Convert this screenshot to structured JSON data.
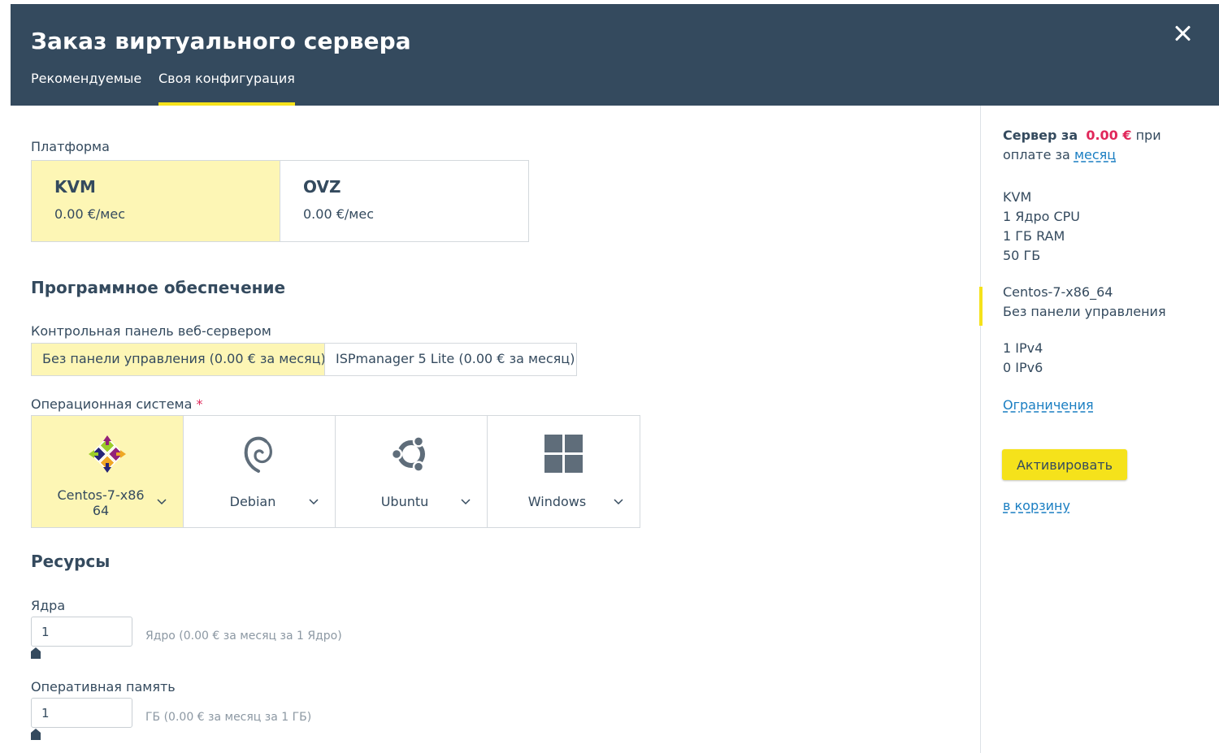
{
  "header": {
    "title": "Заказ виртуального сервера",
    "tabs": [
      {
        "label": "Рекомендуемые",
        "active": false
      },
      {
        "label": "Своя конфигурация",
        "active": true
      }
    ]
  },
  "platform": {
    "label": "Платформа",
    "options": [
      {
        "name": "KVM",
        "price": "0.00 €/мес",
        "selected": true
      },
      {
        "name": "OVZ",
        "price": "0.00 €/мес",
        "selected": false
      }
    ]
  },
  "software": {
    "heading": "Программное обеспечение",
    "panel_label": "Контрольная панель веб-сервером",
    "panel_options": [
      {
        "label": "Без панели управления (0.00 € за месяц)",
        "selected": true
      },
      {
        "label": "ISPmanager 5 Lite (0.00 € за месяц)",
        "selected": false
      }
    ],
    "os_label": "Операционная система",
    "os_required_mark": "*",
    "os_options": [
      {
        "label": "Centos-7-x86\n64",
        "icon": "centos-icon",
        "selected": true
      },
      {
        "label": "Debian",
        "icon": "debian-icon",
        "selected": false
      },
      {
        "label": "Ubuntu",
        "icon": "ubuntu-icon",
        "selected": false
      },
      {
        "label": "Windows",
        "icon": "windows-icon",
        "selected": false
      }
    ]
  },
  "resources": {
    "heading": "Ресурсы",
    "cores": {
      "label": "Ядра",
      "value": "1",
      "hint": "Ядро (0.00 € за месяц за 1 Ядро)"
    },
    "ram": {
      "label": "Оперативная память",
      "value": "1",
      "hint": "ГБ (0.00 € за месяц за 1 ГБ)"
    }
  },
  "summary": {
    "server_prefix": "Сервер за",
    "price": "0.00 €",
    "suffix": "при",
    "period_prefix": "оплате за",
    "period_link": "месяц",
    "config": [
      "KVM",
      "1 Ядро CPU",
      "1 ГБ RAM",
      "50 ГБ"
    ],
    "software": [
      "Centos-7-x86_64",
      "Без панели управления"
    ],
    "ips": [
      "1 IPv4",
      "0 IPv6"
    ],
    "limits_link": "Ограничения",
    "activate_button": "Активировать",
    "cart_link": "в корзину"
  },
  "colors": {
    "header_bg": "#344a5e",
    "accent_yellow": "#f5e21b",
    "selected_bg": "#fdf6b5",
    "price_pink": "#e0275a",
    "link_blue": "#1a7ec2"
  }
}
